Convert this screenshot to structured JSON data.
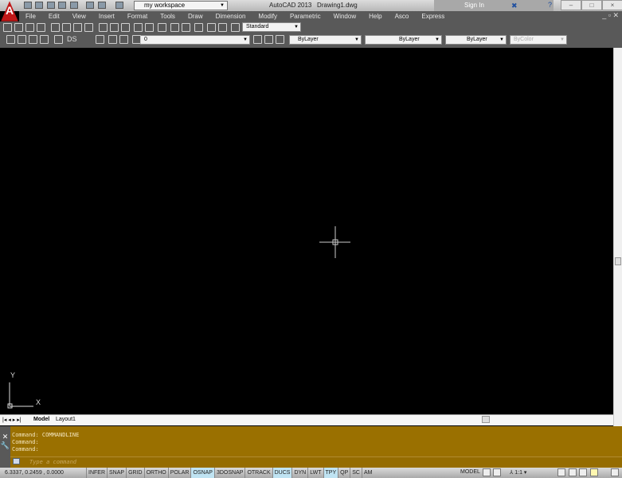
{
  "title_bar": {
    "app": "AutoCAD 2013",
    "file": "Drawing1.dwg",
    "workspace": "my workspace",
    "sign_in": "Sign In",
    "logo": "A"
  },
  "menu": [
    "File",
    "Edit",
    "View",
    "Insert",
    "Format",
    "Tools",
    "Draw",
    "Dimension",
    "Modify",
    "Parametric",
    "Window",
    "Help",
    "Asco",
    "Express"
  ],
  "toolbar": {
    "dim_style": "Standard",
    "layer": "0",
    "color": "ByLayer",
    "linetype": "ByLayer",
    "lineweight": "ByLayer",
    "plot_style": "ByColor",
    "ds_label": "DS"
  },
  "ucs": {
    "x": "X",
    "y": "Y"
  },
  "tabs": [
    "Model",
    "Layout1"
  ],
  "command": {
    "history": [
      "Command: COMMANDLINE",
      "Command:",
      "Command:"
    ],
    "placeholder": "Type a command"
  },
  "status": {
    "coords": "6.3337, 0.2459 , 0.0000",
    "toggles": [
      {
        "label": "INFER",
        "on": false
      },
      {
        "label": "SNAP",
        "on": false
      },
      {
        "label": "GRID",
        "on": false
      },
      {
        "label": "ORTHO",
        "on": false
      },
      {
        "label": "POLAR",
        "on": false
      },
      {
        "label": "OSNAP",
        "on": true
      },
      {
        "label": "3DOSNAP",
        "on": false
      },
      {
        "label": "OTRACK",
        "on": false
      },
      {
        "label": "DUCS",
        "on": true
      },
      {
        "label": "DYN",
        "on": false
      },
      {
        "label": "LWT",
        "on": false
      },
      {
        "label": "TPY",
        "on": true
      },
      {
        "label": "QP",
        "on": false
      },
      {
        "label": "SC",
        "on": false
      },
      {
        "label": "AM",
        "on": false
      }
    ],
    "model": "MODEL",
    "scale": "1:1"
  },
  "colors": {
    "command_bg": "#9a7000",
    "menu_bg": "#595959",
    "toggle_on": "#bfe3f2"
  }
}
